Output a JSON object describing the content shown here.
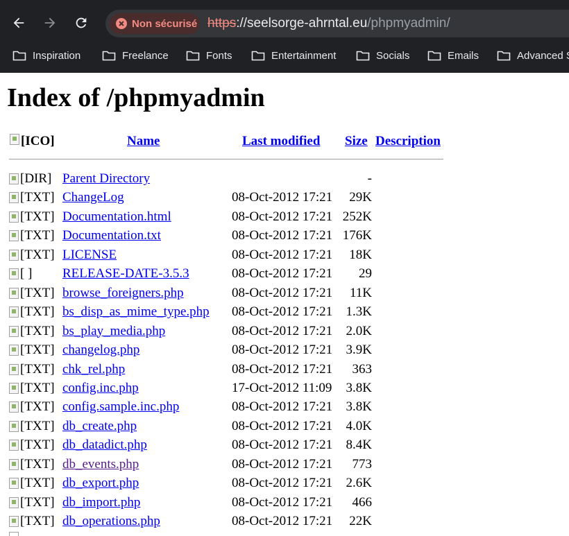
{
  "browser": {
    "security_chip": "Non sécurisé",
    "url_scheme": "https",
    "url_sep": "://",
    "url_host": "seelsorge-ahrntal.eu",
    "url_path": "/phpmyadmin/",
    "bookmarks": [
      "Inspiration",
      "Freelance",
      "Fonts",
      "Entertainment",
      "Socials",
      "Emails",
      "Advanced S"
    ]
  },
  "page": {
    "title": "Index of /phpmyadmin",
    "headers": {
      "icon_alt": "[ICO]",
      "name": "Name",
      "last_modified": "Last modified",
      "size": "Size",
      "description": "Description"
    },
    "rows": [
      {
        "icon": "[DIR]",
        "name": "Parent Directory",
        "modified": "",
        "size": "-"
      },
      {
        "icon": "[TXT]",
        "name": "ChangeLog",
        "modified": "08-Oct-2012 17:21",
        "size": "29K"
      },
      {
        "icon": "[TXT]",
        "name": "Documentation.html",
        "modified": "08-Oct-2012 17:21",
        "size": "252K"
      },
      {
        "icon": "[TXT]",
        "name": "Documentation.txt",
        "modified": "08-Oct-2012 17:21",
        "size": "176K"
      },
      {
        "icon": "[TXT]",
        "name": "LICENSE",
        "modified": "08-Oct-2012 17:21",
        "size": "18K"
      },
      {
        "icon": "[ ]",
        "name": "RELEASE-DATE-3.5.3",
        "modified": "08-Oct-2012 17:21",
        "size": "29"
      },
      {
        "icon": "[TXT]",
        "name": "browse_foreigners.php",
        "modified": "08-Oct-2012 17:21",
        "size": "11K"
      },
      {
        "icon": "[TXT]",
        "name": "bs_disp_as_mime_type.php",
        "modified": "08-Oct-2012 17:21",
        "size": "1.3K"
      },
      {
        "icon": "[TXT]",
        "name": "bs_play_media.php",
        "modified": "08-Oct-2012 17:21",
        "size": "2.0K"
      },
      {
        "icon": "[TXT]",
        "name": "changelog.php",
        "modified": "08-Oct-2012 17:21",
        "size": "3.9K"
      },
      {
        "icon": "[TXT]",
        "name": "chk_rel.php",
        "modified": "08-Oct-2012 17:21",
        "size": "363"
      },
      {
        "icon": "[TXT]",
        "name": "config.inc.php",
        "modified": "17-Oct-2012 11:09",
        "size": "3.8K"
      },
      {
        "icon": "[TXT]",
        "name": "config.sample.inc.php",
        "modified": "08-Oct-2012 17:21",
        "size": "3.8K"
      },
      {
        "icon": "[TXT]",
        "name": "db_create.php",
        "modified": "08-Oct-2012 17:21",
        "size": "4.0K"
      },
      {
        "icon": "[TXT]",
        "name": "db_datadict.php",
        "modified": "08-Oct-2012 17:21",
        "size": "8.4K"
      },
      {
        "icon": "[TXT]",
        "name": "db_events.php",
        "modified": "08-Oct-2012 17:21",
        "size": "773",
        "visited": true
      },
      {
        "icon": "[TXT]",
        "name": "db_export.php",
        "modified": "08-Oct-2012 17:21",
        "size": "2.6K"
      },
      {
        "icon": "[TXT]",
        "name": "db_import.php",
        "modified": "08-Oct-2012 17:21",
        "size": "466"
      },
      {
        "icon": "[TXT]",
        "name": "db_operations.php",
        "modified": "08-Oct-2012 17:21",
        "size": "22K"
      }
    ]
  },
  "colors": {
    "chrome_bg": "#202124",
    "omnibox_bg": "#35363a",
    "warning": "#f28b82",
    "link": "#0000ee",
    "visited": "#551a8b"
  }
}
